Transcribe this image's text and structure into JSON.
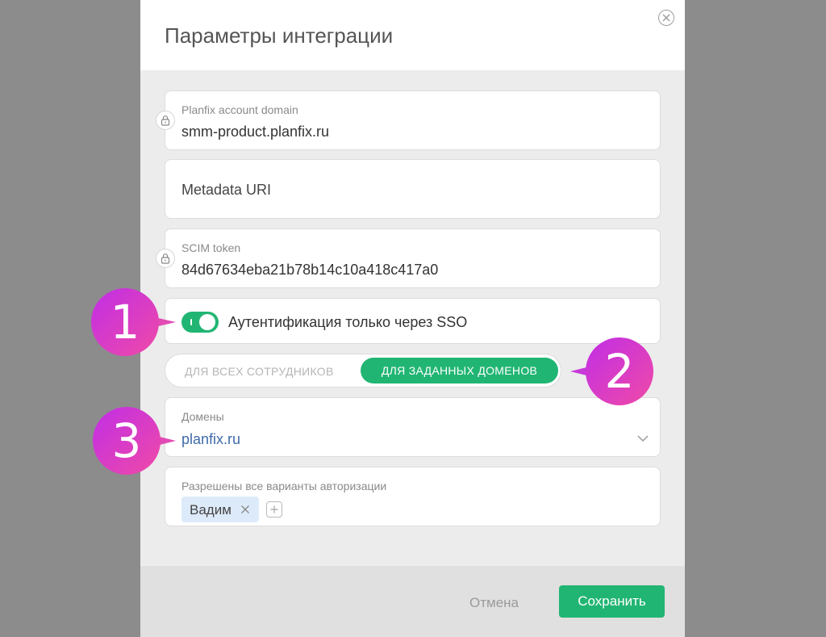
{
  "dialog": {
    "title": "Параметры интеграции"
  },
  "fields": {
    "account_domain": {
      "label": "Planfix account domain",
      "value": "smm-product.planfix.ru"
    },
    "metadata_uri": {
      "placeholder": "Metadata URI"
    },
    "scim_token": {
      "label": "SCIM token",
      "value": "84d67634eba21b78b14c10a418c417a0"
    }
  },
  "sso": {
    "label": "Аутентификация только через SSO",
    "enabled": true
  },
  "scope_switch": {
    "options": [
      "ДЛЯ ВСЕХ СОТРУДНИКОВ",
      "ДЛЯ ЗАДАННЫХ ДОМЕНОВ"
    ],
    "selected": "ДЛЯ ЗАДАННЫХ ДОМЕНОВ"
  },
  "domains": {
    "label": "Домены",
    "value": "planfix.ru"
  },
  "all_auth": {
    "label": "Разрешены все варианты авторизации",
    "chips": [
      "Вадим"
    ]
  },
  "footer": {
    "cancel_label": "Отмена",
    "save_label": "Сохранить"
  },
  "callouts": [
    "1",
    "2",
    "3"
  ],
  "colors": {
    "accent": "#21b573",
    "domain_text": "#3f6aa8",
    "chip_bg": "#ddeaf9"
  }
}
